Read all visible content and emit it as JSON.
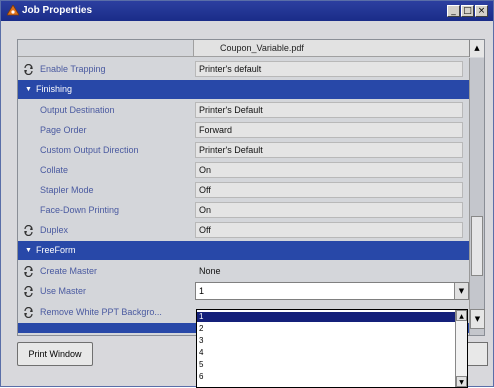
{
  "window": {
    "title": "Job Properties",
    "controls": {
      "minimize": "_",
      "maximize": "□",
      "close": "×"
    }
  },
  "header": {
    "file_name": "Coupon_Variable.pdf",
    "scroll_up_glyph": "▲"
  },
  "rows": {
    "enable_trapping": {
      "label": "Enable Trapping",
      "value": "Printer's default"
    },
    "finishing_section": {
      "title": "Finishing",
      "glyph": "▼"
    },
    "output_destination": {
      "label": "Output Destination",
      "value": "Printer's Default"
    },
    "page_order": {
      "label": "Page Order",
      "value": "Forward"
    },
    "custom_output_direction": {
      "label": "Custom Output Direction",
      "value": "Printer's Default"
    },
    "collate": {
      "label": "Collate",
      "value": "On"
    },
    "stapler_mode": {
      "label": "Stapler Mode",
      "value": "Off"
    },
    "face_down_printing": {
      "label": "Face-Down Printing",
      "value": "On"
    },
    "duplex": {
      "label": "Duplex",
      "value": "Off"
    },
    "freeform_section": {
      "title": "FreeForm",
      "glyph": "▼"
    },
    "create_master": {
      "label": "Create Master",
      "value": "None"
    },
    "use_master": {
      "label": "Use Master",
      "value": "1"
    },
    "remove_white": {
      "label": "Remove White PPT Backgro...",
      "value": ""
    }
  },
  "dropdown": {
    "options": [
      "1",
      "2",
      "3",
      "4",
      "5",
      "6"
    ],
    "selected": "1",
    "arrow_glyph": "▼"
  },
  "footer": {
    "print_button": "Print Window"
  },
  "colors": {
    "title_bar": "#1f33a0",
    "section_header": "#2848a8",
    "label_text": "#4a5aa0",
    "selection": "#14207a"
  },
  "icons": {
    "app": "job-properties-icon",
    "cycle": "cycle-icon"
  }
}
